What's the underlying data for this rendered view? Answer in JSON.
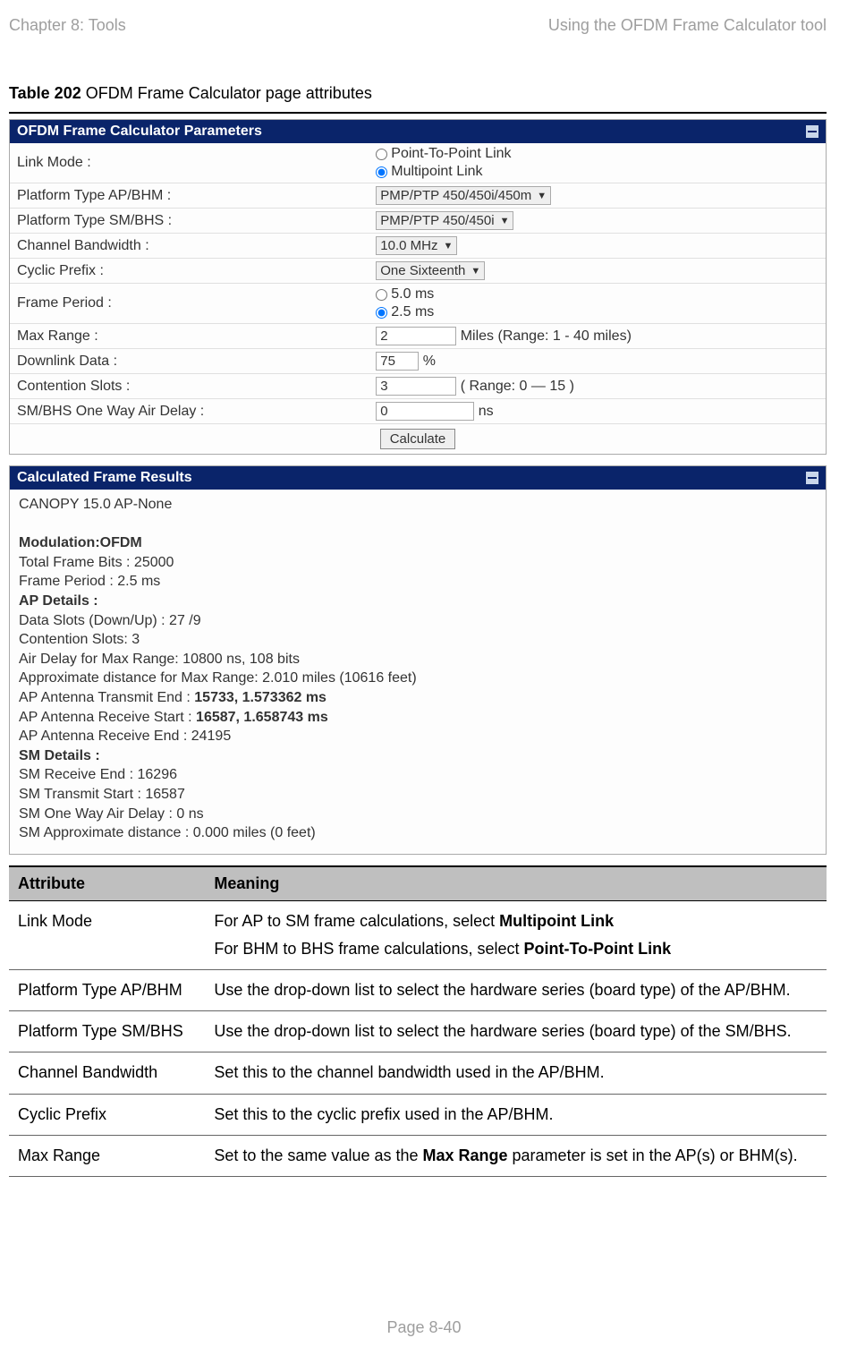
{
  "header": {
    "left": "Chapter 8:  Tools",
    "right": "Using the OFDM Frame Calculator tool"
  },
  "footer": {
    "page_label": "Page 8-40"
  },
  "caption": {
    "table_num": "Table 202",
    "table_title": " OFDM Frame Calculator page attributes"
  },
  "params_panel": {
    "title": "OFDM Frame Calculator Parameters",
    "rows": {
      "link_mode_label": "Link Mode :",
      "link_mode_opt1": "Point-To-Point Link",
      "link_mode_opt2": "Multipoint Link",
      "platform_ap_label": "Platform Type AP/BHM :",
      "platform_ap_value": "PMP/PTP 450/450i/450m",
      "platform_sm_label": "Platform Type SM/BHS :",
      "platform_sm_value": "PMP/PTP 450/450i",
      "chan_bw_label": "Channel Bandwidth :",
      "chan_bw_value": "10.0 MHz",
      "cyclic_prefix_label": "Cyclic Prefix :",
      "cyclic_prefix_value": "One Sixteenth",
      "frame_period_label": "Frame Period :",
      "frame_period_opt1": "5.0 ms",
      "frame_period_opt2": "2.5 ms",
      "max_range_label": "Max Range :",
      "max_range_value": "2",
      "max_range_units": "Miles (Range: 1 - 40 miles)",
      "downlink_label": "Downlink Data :",
      "downlink_value": "75",
      "downlink_units": "%",
      "contention_label": "Contention Slots :",
      "contention_value": "3",
      "contention_units": "( Range: 0 — 15 )",
      "air_delay_label": "SM/BHS One Way Air Delay :",
      "air_delay_value": "0",
      "air_delay_units": "ns",
      "calculate_btn": "Calculate"
    }
  },
  "results_panel": {
    "title": "Calculated Frame Results",
    "line1": "CANOPY 15.0  AP-None",
    "modulation_label": "Modulation:OFDM",
    "total_frame_bits": "Total Frame Bits : 25000",
    "frame_period": "Frame Period : 2.5 ms",
    "ap_details_label": "AP Details :",
    "data_slots": "Data Slots (Down/Up) : 27 /9",
    "contention_slots": "Contention Slots: 3",
    "air_delay_max": "Air Delay for Max Range: 10800 ns, 108 bits",
    "approx_dist": "Approximate distance for Max Range: 2.010 miles (10616 feet)",
    "ap_tx_end_pre": "AP Antenna Transmit End : ",
    "ap_tx_end_val": "15733, 1.573362 ms",
    "ap_rx_start_pre": "AP Antenna Receive Start : ",
    "ap_rx_start_val": "16587, 1.658743 ms",
    "ap_rx_end": "AP Antenna Receive End : 24195",
    "sm_details_label": "SM Details :",
    "sm_rx_end": "SM Receive End : 16296",
    "sm_tx_start": "SM Transmit Start : 16587",
    "sm_air_delay": "SM One Way Air Delay : 0 ns",
    "sm_approx_dist": "SM Approximate distance : 0.000 miles (0 feet)"
  },
  "attr_table": {
    "head_attr": "Attribute",
    "head_meaning": "Meaning",
    "rows": [
      {
        "attr": "Link Mode",
        "meaning_parts": [
          {
            "pre": "For AP to SM frame calculations, select ",
            "strong": "Multipoint Link",
            "post": ""
          },
          {
            "pre": "For BHM to BHS frame calculations, select ",
            "strong": "Point-To-Point Link",
            "post": ""
          }
        ]
      },
      {
        "attr": "Platform Type AP/BHM",
        "meaning": "Use the drop-down list to select the hardware series (board type) of the AP/BHM."
      },
      {
        "attr": "Platform Type SM/BHS",
        "meaning": "Use the drop-down list to select the hardware series (board type) of the SM/BHS."
      },
      {
        "attr": "Channel Bandwidth",
        "meaning": "Set this to the channel bandwidth used in the AP/BHM."
      },
      {
        "attr": "Cyclic Prefix",
        "meaning": "Set this to the cyclic prefix used in the AP/BHM."
      },
      {
        "attr": "Max Range",
        "meaning_parts": [
          {
            "pre": "Set to the same value as the ",
            "strong": "Max Range",
            "post": " parameter is set in the AP(s) or BHM(s)."
          }
        ]
      }
    ]
  }
}
